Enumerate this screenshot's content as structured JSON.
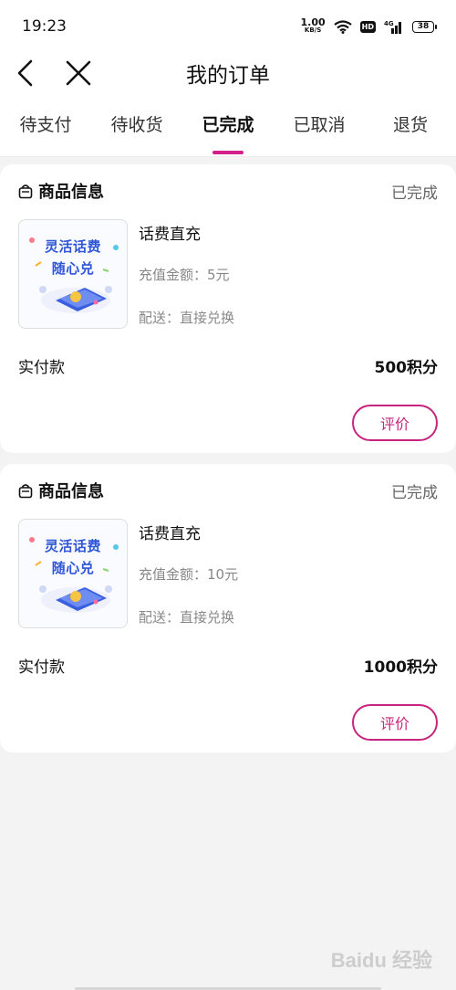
{
  "status_bar": {
    "time": "19:23",
    "net_speed": "1.00",
    "net_unit": "KB/S",
    "hd": "HD",
    "signal": "4G",
    "battery": "38"
  },
  "header": {
    "title": "我的订单"
  },
  "tabs": [
    {
      "label": "待支付",
      "active": false
    },
    {
      "label": "待收货",
      "active": false
    },
    {
      "label": "已完成",
      "active": true
    },
    {
      "label": "已取消",
      "active": false
    },
    {
      "label": "退货",
      "active": false
    }
  ],
  "orders": [
    {
      "section_title": "商品信息",
      "status": "已完成",
      "thumb_line1": "灵活话费",
      "thumb_line2": "随心兑",
      "product_name": "话费直充",
      "recharge_amount": "充值金额：5元",
      "delivery": "配送：直接兑换",
      "paid_label": "实付款",
      "paid_value": "500积分",
      "review_label": "评价"
    },
    {
      "section_title": "商品信息",
      "status": "已完成",
      "thumb_line1": "灵活话费",
      "thumb_line2": "随心兑",
      "product_name": "话费直充",
      "recharge_amount": "充值金额：10元",
      "delivery": "配送：直接兑换",
      "paid_label": "实付款",
      "paid_value": "1000积分",
      "review_label": "评价"
    }
  ],
  "watermark": "Baidu 经验",
  "colors": {
    "accent": "#c8237e",
    "tab_underline": "#d31f8a",
    "thumb_text": "#2f56d6"
  }
}
